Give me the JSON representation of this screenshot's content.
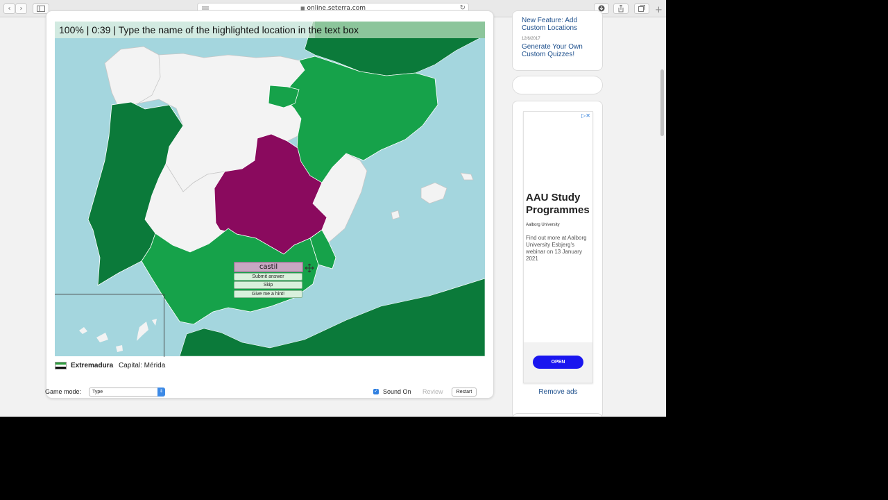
{
  "browser": {
    "url": "online.seterra.com",
    "back_icon": "chevron-left-icon",
    "forward_icon": "chevron-right-icon",
    "sidebar_icon": "sidebar-icon",
    "reader_icon": "reader-icon",
    "lock_icon": "lock-icon",
    "reload_icon": "reload-icon",
    "download_icon": "download-icon",
    "share_icon": "share-icon",
    "tabs_icon": "tabs-icon",
    "new_tab_icon": "plus-icon"
  },
  "game": {
    "status": "100% | 0:39 | Type the name of the highlighted location in the text box",
    "answer_value": "castil",
    "submit_label": "Submit answer",
    "skip_label": "Skip",
    "hint_label": "Give me a hint!",
    "region_name": "Extremadura",
    "capital": "Capital: Mérida",
    "flag_colors": [
      "#2e9e3e",
      "#ffffff",
      "#111111"
    ],
    "colors": {
      "sea": "#a4d6de",
      "unsolved": "#f3f3f3",
      "solved_light": "#16a24a",
      "solved_dark": "#0b7a3a",
      "highlighted": "#8a0a5e"
    }
  },
  "controls": {
    "mode_label": "Game mode:",
    "mode_value": "Type",
    "sound_label": "Sound On",
    "sound_checked": true,
    "review_label": "Review",
    "restart_label": "Restart"
  },
  "sidebar": {
    "news": [
      {
        "title": "New Feature: Add Custom Locations"
      },
      {
        "date": "12/6/2017",
        "title": "Generate Your Own Custom Quizzes!"
      }
    ],
    "ad": {
      "title": "AAU Study Programmes",
      "company": "Aalborg University",
      "body": "Find out more at Aalborg University Esbjerg's webinar on 13 January 2021",
      "cta": "OPEN"
    },
    "remove_ads": "Remove ads"
  }
}
